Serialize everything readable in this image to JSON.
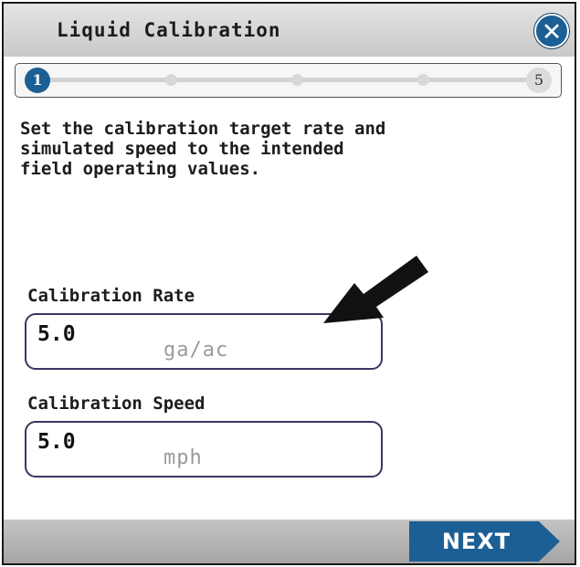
{
  "dialog": {
    "title": "Liquid Calibration",
    "close_icon": "close-icon"
  },
  "progress": {
    "current_step": "1",
    "total_steps": "5"
  },
  "instructions": "Set the calibration target rate and\nsimulated speed to the intended\nfield operating values.",
  "calibration_rate": {
    "label": "Calibration Rate",
    "value": "5.0",
    "unit": "ga/ac"
  },
  "calibration_speed": {
    "label": "Calibration Speed",
    "value": "5.0",
    "unit": "mph"
  },
  "footer": {
    "next_label": "NEXT"
  },
  "colors": {
    "accent": "#1b5f95",
    "field_border": "#3a3563",
    "header_gray": "#d4d4d4"
  }
}
